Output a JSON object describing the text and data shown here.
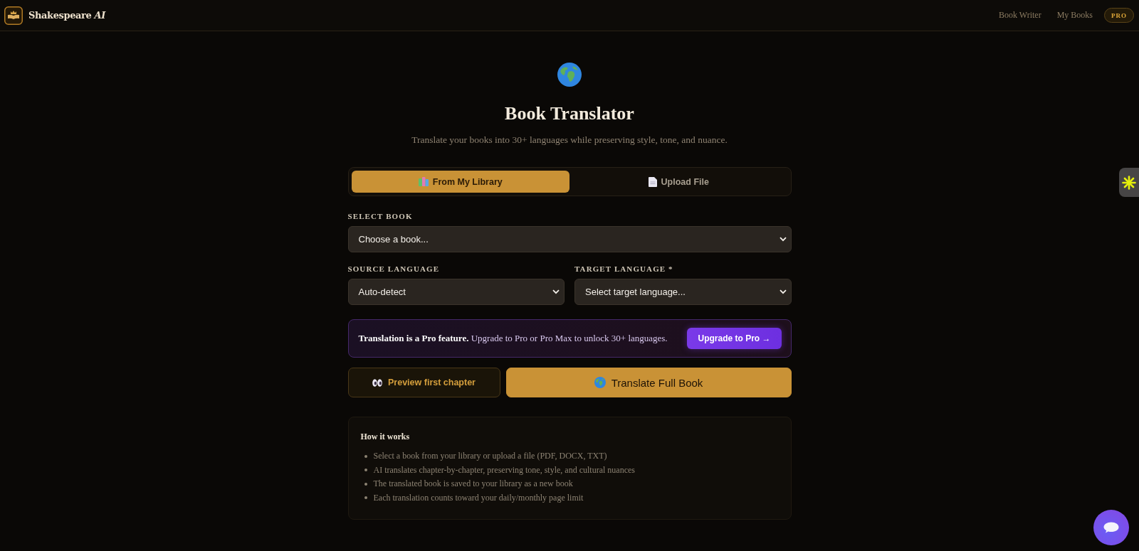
{
  "header": {
    "brand": "Shakespeare *AI*",
    "nav": [
      {
        "label": "Book Writer"
      },
      {
        "label": "My Books"
      }
    ],
    "plan_badge": "PRO"
  },
  "page": {
    "title": "Book Translator",
    "subtitle": "Translate your books into 30+ languages while preserving style, tone, and nuance."
  },
  "source_tabs": [
    {
      "label": "From My Library",
      "selected": true
    },
    {
      "label": "Upload File",
      "selected": false
    }
  ],
  "book_field": {
    "label": "SELECT BOOK",
    "value": "Choose a book..."
  },
  "language_fields": [
    {
      "label": "SOURCE LANGUAGE",
      "value": "Auto-detect"
    },
    {
      "label": "TARGET LANGUAGE *",
      "value": "Select target language..."
    }
  ],
  "pro_notice": {
    "text": "**Translation is a Pro feature.** Upgrade to Pro or Pro Max to unlock 30+ languages.",
    "button": "Upgrade to Pro →"
  },
  "actions": [
    {
      "label": "Preview first chapter",
      "kind": "secondary"
    },
    {
      "label": "Translate Full Book",
      "kind": "primary"
    }
  ],
  "how_it_works": {
    "title": "How it works",
    "steps": [
      "Select a book from your library or upload a file (PDF, DOCX, TXT)",
      "AI translates chapter-by-chapter, preserving tone, style, and cultural nuances",
      "The translated book is saved to your library as a new book",
      "Each translation counts toward your daily/monthly page limit"
    ]
  }
}
